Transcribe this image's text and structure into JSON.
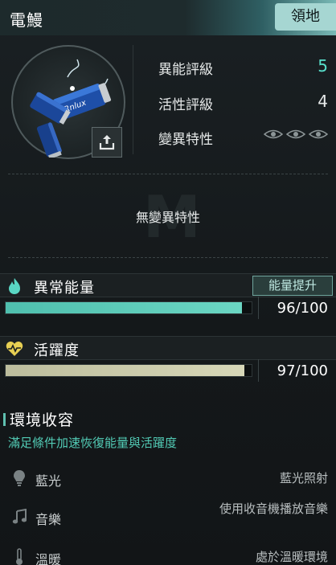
{
  "header": {
    "title": "電鰻",
    "tag": "領地"
  },
  "creature": {
    "image_label": "Rnlux",
    "stats": [
      {
        "label": "異能評級",
        "value": "5"
      },
      {
        "label": "活性評級",
        "value": "4"
      },
      {
        "label": "變異特性"
      }
    ],
    "mutation_text": "無變異特性",
    "watermark": "M"
  },
  "energy": {
    "title": "異常能量",
    "value": "96/100",
    "fraction": 0.96,
    "button": "能量提升",
    "color": "#6bd6c3"
  },
  "activity": {
    "title": "活躍度",
    "value": "97/100",
    "fraction": 0.97,
    "color": "#d7d7b8"
  },
  "environment": {
    "title": "環境收容",
    "subtitle": "滿足條件加速恢復能量與活躍度",
    "items": [
      {
        "icon": "lightbulb-icon",
        "name": "藍光",
        "desc": "藍光照射"
      },
      {
        "icon": "music-note-icon",
        "name": "音樂",
        "desc": "使用收音機播放音樂"
      },
      {
        "icon": "thermometer-icon",
        "name": "溫暖",
        "desc": "處於溫暖環境"
      }
    ]
  }
}
